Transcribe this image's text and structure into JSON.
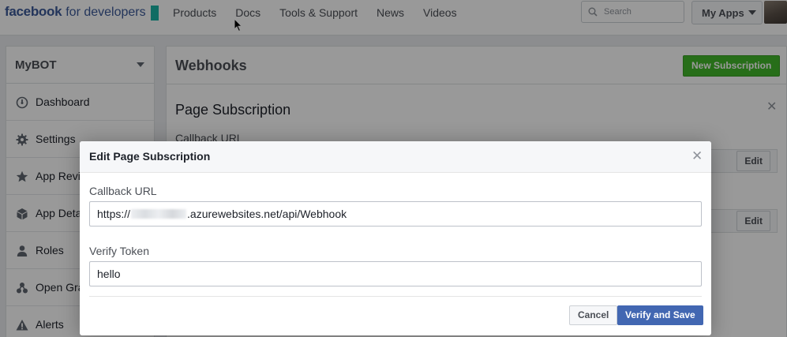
{
  "topbar": {
    "logo_brand": "facebook",
    "logo_suffix": "for developers",
    "nav": [
      "Products",
      "Docs",
      "Tools & Support",
      "News",
      "Videos"
    ],
    "search_placeholder": "Search",
    "myapps_label": "My Apps"
  },
  "sidebar": {
    "app_name": "MyBOT",
    "items": [
      {
        "label": "Dashboard",
        "icon": "dashboard-icon"
      },
      {
        "label": "Settings",
        "icon": "gear-icon"
      },
      {
        "label": "App Revi",
        "icon": "star-icon"
      },
      {
        "label": "App Deta",
        "icon": "cube-icon"
      },
      {
        "label": "Roles",
        "icon": "person-icon"
      },
      {
        "label": "Open Gra",
        "icon": "graph-icon"
      },
      {
        "label": "Alerts",
        "icon": "warning-icon"
      }
    ]
  },
  "main": {
    "title": "Webhooks",
    "new_subscription_label": "New Subscription",
    "panel_title": "Page Subscription",
    "callback_label": "Callback URL",
    "edit_label": "Edit"
  },
  "modal": {
    "title": "Edit Page Subscription",
    "callback_label": "Callback URL",
    "callback_prefix": "https://",
    "callback_suffix": ".azurewebsites.net/api/Webhook",
    "verify_label": "Verify Token",
    "verify_value": "hello",
    "cancel_label": "Cancel",
    "verify_save_label": "Verify and Save"
  },
  "colors": {
    "brand_blue": "#3b5998",
    "logo_teal": "#1cb5a6",
    "primary_button": "#4267b2",
    "success_button": "#42b72a"
  }
}
